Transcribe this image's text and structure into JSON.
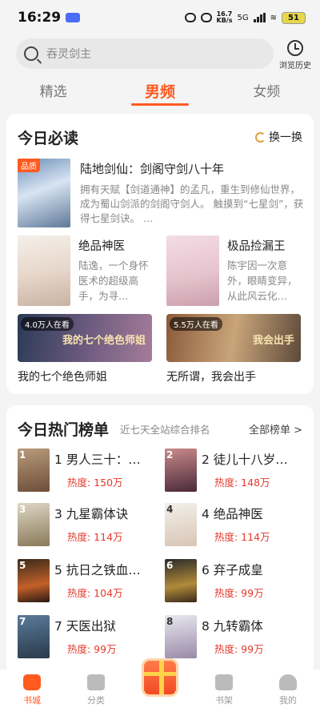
{
  "status": {
    "time": "16:29",
    "net_speed": "16.7",
    "net_unit": "KB/s",
    "signal": "5G",
    "battery": "51"
  },
  "search": {
    "placeholder": "吞灵剑主",
    "history_label": "浏览历史"
  },
  "tabs": [
    {
      "label": "精选",
      "active": false
    },
    {
      "label": "男频",
      "active": true
    },
    {
      "label": "女频",
      "active": false
    }
  ],
  "must_read": {
    "title": "今日必读",
    "refresh_label": "换一换",
    "featured": {
      "tag": "品质",
      "title": "陆地剑仙：剑阁守剑八十年",
      "desc": "拥有天赋【剑道通神】的孟凡，重生到修仙世界，成为蜀山剑派的剑阁守剑人。 触摸到“七星剑”，获得七星剑诀。 …"
    },
    "books": [
      {
        "title": "绝品神医",
        "desc": "陆逸，一个身怀医术的超级高手，为寻…"
      },
      {
        "title": "极品捡漏王",
        "desc": "陈宇因一次意外，眼睛变异，从此风云化…"
      }
    ],
    "banners": [
      {
        "badge": "4.0万人在看",
        "art_text": "我的七个绝色师姐",
        "label": "我的七个绝色师姐"
      },
      {
        "badge": "5.5万人在看",
        "art_text": "我会出手",
        "label": "无所谓，我会出手"
      }
    ]
  },
  "ranking": {
    "title": "今日热门榜单",
    "subtitle": "近七天全站综合排名",
    "all_label": "全部榜单 >",
    "items": [
      {
        "rank": "1",
        "title": "1 男人三十：…",
        "heat": "热度: 150万"
      },
      {
        "rank": "2",
        "title": "2 徒儿十八岁…",
        "heat": "热度: 148万"
      },
      {
        "rank": "3",
        "title": "3 九星霸体诀",
        "heat": "热度: 114万"
      },
      {
        "rank": "4",
        "title": "4 绝品神医",
        "heat": "热度: 114万"
      },
      {
        "rank": "5",
        "title": "5 抗日之铁血…",
        "heat": "热度: 104万"
      },
      {
        "rank": "6",
        "title": "6 弃子成皇",
        "heat": "热度: 99万"
      },
      {
        "rank": "7",
        "title": "7 天医出狱",
        "heat": "热度: 99万"
      },
      {
        "rank": "8",
        "title": "8 九转霸体",
        "heat": "热度: 99万"
      }
    ]
  },
  "nav": [
    {
      "label": "书城",
      "icon": "bookstore-icon",
      "active": true
    },
    {
      "label": "分类",
      "icon": "category-icon",
      "active": false
    },
    {
      "label": "",
      "icon": "gift-icon",
      "active": false
    },
    {
      "label": "书架",
      "icon": "bookshelf-icon",
      "active": false
    },
    {
      "label": "我的",
      "icon": "profile-icon",
      "active": false
    }
  ],
  "colors": {
    "accent": "#ff5a1f",
    "heat": "#e4392b"
  }
}
